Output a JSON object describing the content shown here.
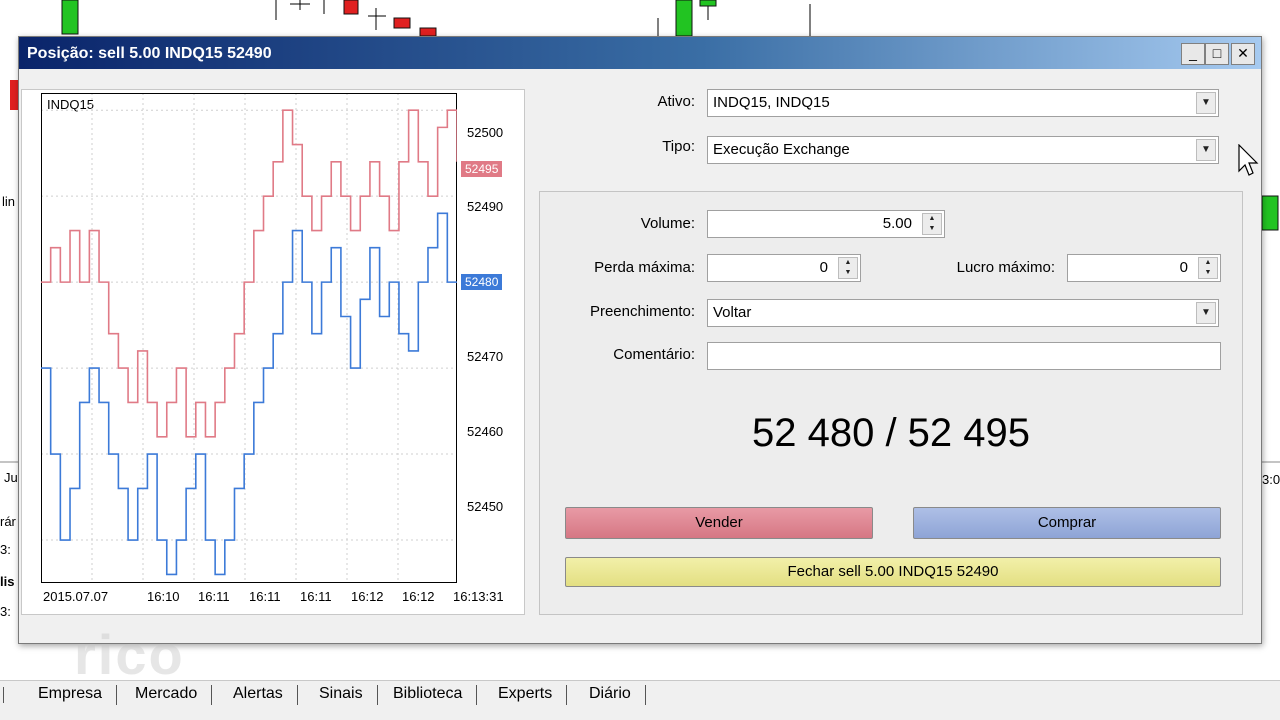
{
  "window": {
    "title": "Posição: sell 5.00 INDQ15 52490",
    "controls": {
      "minimize": "_",
      "maximize": "□",
      "close": "✕"
    }
  },
  "mini_chart": {
    "symbol": "INDQ15",
    "price_labels": [
      "52500",
      "52490",
      "52470",
      "52460",
      "52450"
    ],
    "ask_flag": "52495",
    "bid_flag": "52480",
    "time_labels": [
      "2015.07.07",
      "16:10",
      "16:11",
      "16:11",
      "16:11",
      "16:12",
      "16:12",
      "16:13:31"
    ],
    "ask_color": "#e07a86",
    "bid_color": "#3c7ad8",
    "ylim": [
      52445,
      52502
    ],
    "ask_series": [
      52480,
      52484,
      52480,
      52486,
      52480,
      52486,
      52480,
      52474,
      52470,
      52466,
      52472,
      52466,
      52462,
      52466,
      52470,
      52462,
      52466,
      52462,
      52466,
      52470,
      52474,
      52480,
      52486,
      52490,
      52494,
      52500,
      52496,
      52490,
      52486,
      52490,
      52494,
      52490,
      52486,
      52490,
      52494,
      52490,
      52486,
      52494,
      52500,
      52494,
      52490,
      52498,
      52500,
      52494
    ],
    "bid_series": [
      52470,
      52460,
      52450,
      52456,
      52466,
      52470,
      52466,
      52460,
      52456,
      52450,
      52456,
      52460,
      52450,
      52446,
      52450,
      52456,
      52460,
      52450,
      52446,
      52450,
      52456,
      52460,
      52466,
      52470,
      52474,
      52480,
      52486,
      52480,
      52474,
      52480,
      52484,
      52476,
      52470,
      52478,
      52484,
      52476,
      52480,
      52474,
      52472,
      52480,
      52484,
      52488,
      52480,
      52480
    ]
  },
  "form": {
    "ativo_label": "Ativo:",
    "ativo_value": "INDQ15, INDQ15",
    "tipo_label": "Tipo:",
    "tipo_value": "Execução Exchange",
    "volume_label": "Volume:",
    "volume_value": "5.00",
    "perda_label": "Perda máxima:",
    "perda_value": "0",
    "lucro_label": "Lucro máximo:",
    "lucro_value": "0",
    "preenchimento_label": "Preenchimento:",
    "preenchimento_value": "Voltar",
    "comentario_label": "Comentário:",
    "comentario_value": ""
  },
  "quote": "52 480 / 52 495",
  "buttons": {
    "sell": "Vender",
    "buy": "Comprar",
    "close": "Fechar sell 5.00 INDQ15 52490"
  },
  "background": {
    "left_labels": [
      "lin",
      "Ju",
      "rár",
      "3:",
      "lis",
      "3:"
    ],
    "right_label": "3:0"
  },
  "watermark": "rico",
  "tabs": [
    "Empresa",
    "Mercado",
    "Alertas",
    "Sinais",
    "Biblioteca",
    "Experts",
    "Diário"
  ]
}
